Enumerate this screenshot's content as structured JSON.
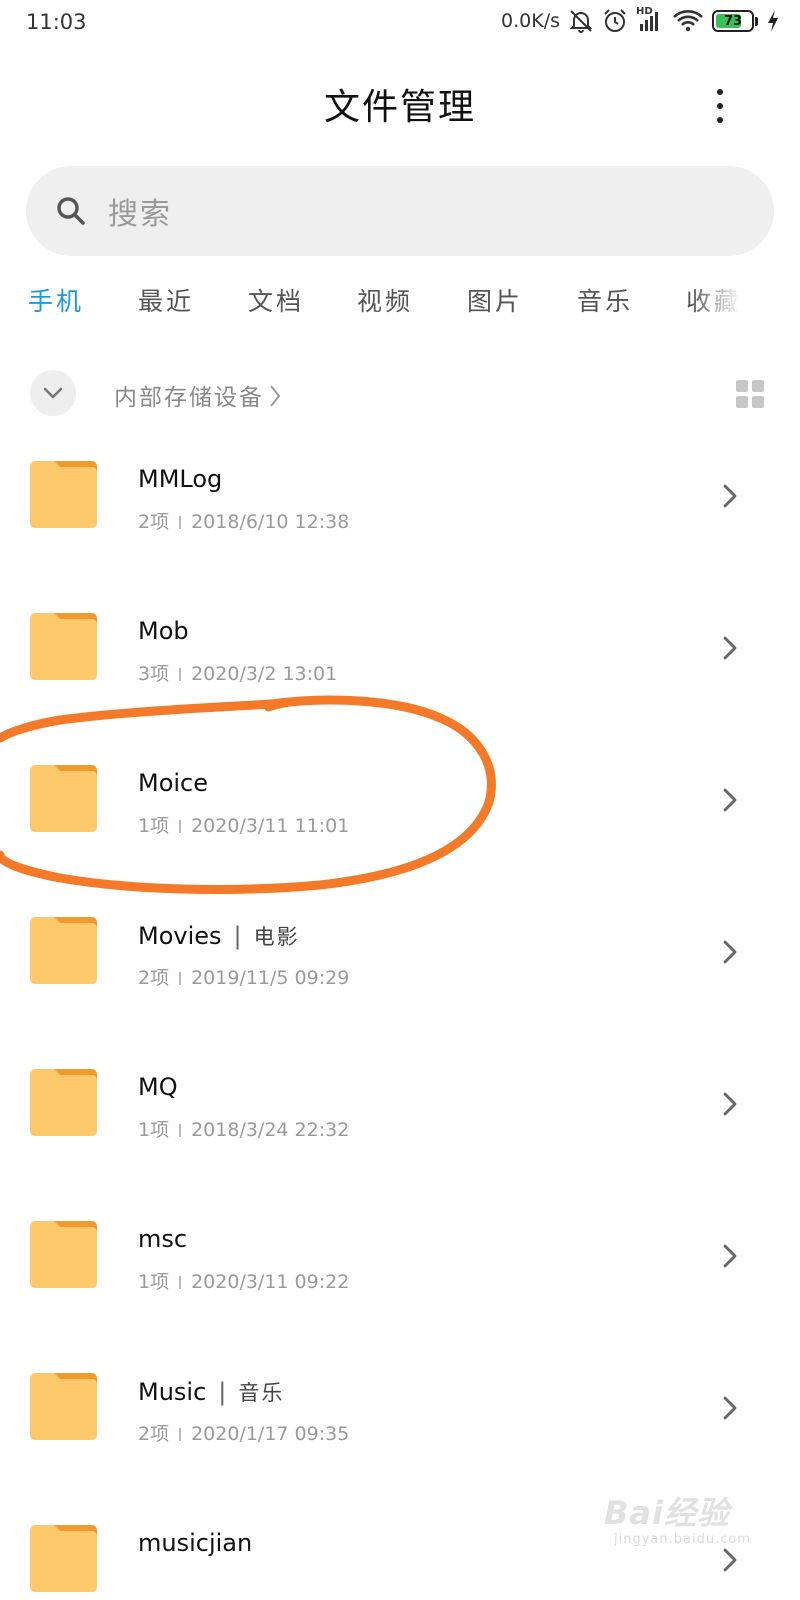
{
  "status_bar": {
    "time": "11:03",
    "network_speed": "0.0K/s",
    "hd_label": "HD",
    "battery_level": "73",
    "icons": [
      "mute-icon",
      "alarm-icon",
      "signal-icon",
      "wifi-icon",
      "battery-icon",
      "charging-icon"
    ]
  },
  "header": {
    "title": "文件管理",
    "more_icon": "more-vertical-icon"
  },
  "search": {
    "placeholder": "搜索",
    "icon": "search-icon"
  },
  "tabs": [
    {
      "label": "手机",
      "active": true
    },
    {
      "label": "最近",
      "active": false
    },
    {
      "label": "文档",
      "active": false
    },
    {
      "label": "视频",
      "active": false
    },
    {
      "label": "图片",
      "active": false
    },
    {
      "label": "音乐",
      "active": false
    },
    {
      "label": "收藏",
      "active": false
    }
  ],
  "path": {
    "label": "内部存储设备",
    "collapse_icon": "chevron-down-icon",
    "view_icon": "grid-view-icon"
  },
  "files": [
    {
      "name": "MMLog",
      "tag": "",
      "count": "2项",
      "date": "2018/6/10 12:38"
    },
    {
      "name": "Mob",
      "tag": "",
      "count": "3项",
      "date": "2020/3/2 13:01"
    },
    {
      "name": "Moice",
      "tag": "",
      "count": "1项",
      "date": "2020/3/11 11:01"
    },
    {
      "name": "Movies",
      "tag": "电影",
      "count": "2项",
      "date": "2019/11/5 09:29"
    },
    {
      "name": "MQ",
      "tag": "",
      "count": "1项",
      "date": "2018/3/24 22:32"
    },
    {
      "name": "msc",
      "tag": "",
      "count": "1项",
      "date": "2020/3/11 09:22"
    },
    {
      "name": "Music",
      "tag": "音乐",
      "count": "2项",
      "date": "2020/1/17 09:35"
    },
    {
      "name": "musicjian",
      "tag": "",
      "count": "",
      "date": ""
    }
  ],
  "colors": {
    "accent": "#1a9be0",
    "folder": "#fdc96b",
    "folder_tab": "#f39a2c",
    "annotation": "#f47a2a"
  },
  "watermark": {
    "main": "Bai经验",
    "sub": "jingyan.baidu.com"
  }
}
